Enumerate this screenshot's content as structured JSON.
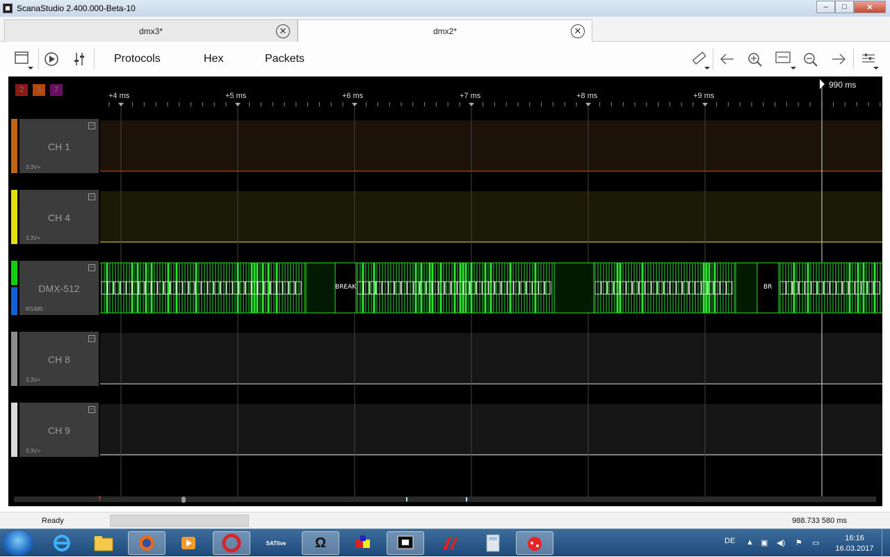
{
  "window": {
    "title": "ScanaStudio 2.400.000-Beta-10",
    "min": "–",
    "max": "□",
    "close": "✕"
  },
  "tabs": [
    {
      "label": "dmx3*",
      "active": false
    },
    {
      "label": "dmx2*",
      "active": true
    }
  ],
  "tab_close_glyph": "✕",
  "toolbar": {
    "protocols": "Protocols",
    "hex": "Hex",
    "packets": "Packets",
    "icons": [
      "window-icon",
      "play-icon",
      "settings-sliders-icon",
      "ruler-icon",
      "arrow-left-icon",
      "zoom-in-icon",
      "fit-icon",
      "zoom-out-icon",
      "arrow-right-icon",
      "preferences-icon"
    ]
  },
  "markers": [
    {
      "label": "2",
      "color": "#8a1a16"
    },
    {
      "label": "3",
      "color": "#b5470c"
    },
    {
      "label": "7",
      "color": "#6b0d63"
    }
  ],
  "ruler": {
    "ticks": [
      "+4 ms",
      "+5 ms",
      "+6 ms",
      "+7 ms",
      "+8 ms",
      "+9 ms"
    ],
    "cursor_label": "990 ms"
  },
  "channels": [
    {
      "name": "CH 1",
      "voltage": "3.3V+",
      "color": "#c26512",
      "lane_bg": "#1c1207",
      "line": "#d64b2f"
    },
    {
      "name": "CH 4",
      "voltage": "3.3V+",
      "color": "#e4dd10",
      "lane_bg": "#1a1a07",
      "line": "#dcd840"
    },
    {
      "name": "DMX-512",
      "voltage": "RS485",
      "color": "#10d010",
      "color2": "#1060d8",
      "lane_bg": "#000000",
      "line": "#2ee52e"
    },
    {
      "name": "CH 8",
      "voltage": "3.3V+",
      "color": "#8c8c8c",
      "lane_bg": "#161616",
      "line": "#d8d8d8"
    },
    {
      "name": "CH 9",
      "voltage": "3.3V+",
      "color": "#d9d9d9",
      "lane_bg": "#161616",
      "line": "#eeeeee"
    }
  ],
  "decoder_labels": [
    "BREAK",
    "BR"
  ],
  "collapse_glyph": "−",
  "status": {
    "text": "Ready",
    "time": "988.733 580 ms"
  },
  "taskbar": {
    "apps": [
      "ie-icon",
      "explorer-icon",
      "firefox-icon",
      "media-icon",
      "ccleaner-icon",
      "satlive-icon",
      "omega-icon",
      "palette-icon",
      "scanastudio-icon",
      "altium-icon",
      "calculator-icon",
      "ladybug-icon"
    ],
    "satlive": "SATlive",
    "omega": "Ω",
    "lang": "DE",
    "time": "16:16",
    "date": "16.03.2017"
  }
}
